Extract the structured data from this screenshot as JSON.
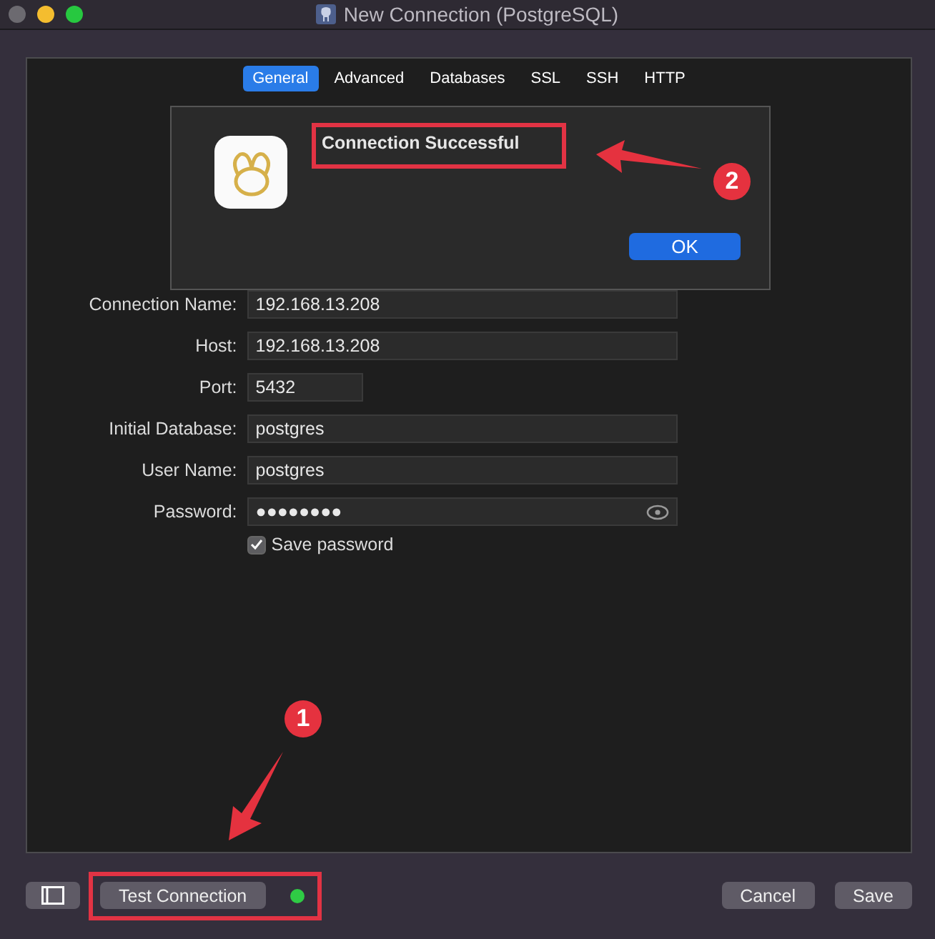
{
  "window": {
    "title": "New Connection (PostgreSQL)"
  },
  "tabs": [
    {
      "label": "General",
      "selected": true
    },
    {
      "label": "Advanced",
      "selected": false
    },
    {
      "label": "Databases",
      "selected": false
    },
    {
      "label": "SSL",
      "selected": false
    },
    {
      "label": "SSH",
      "selected": false
    },
    {
      "label": "HTTP",
      "selected": false
    }
  ],
  "form": {
    "fields": [
      {
        "label": "Connection Name:",
        "value": "192.168.13.208",
        "kind": "text"
      },
      {
        "label": "Host:",
        "value": "192.168.13.208",
        "kind": "text"
      },
      {
        "label": "Port:",
        "value": "5432",
        "kind": "short"
      },
      {
        "label": "Initial Database:",
        "value": "postgres",
        "kind": "text"
      },
      {
        "label": "User Name:",
        "value": "postgres",
        "kind": "text"
      },
      {
        "label": "Password:",
        "value": "●●●●●●●●",
        "kind": "password"
      }
    ],
    "save_password": {
      "label": "Save password",
      "checked": true
    }
  },
  "dialog": {
    "message": "Connection Successful",
    "button": "OK"
  },
  "footer": {
    "test_button": "Test Connection",
    "connected": true,
    "cancel": "Cancel",
    "save": "Save"
  },
  "annotations": [
    {
      "number": "1"
    },
    {
      "number": "2"
    }
  ]
}
